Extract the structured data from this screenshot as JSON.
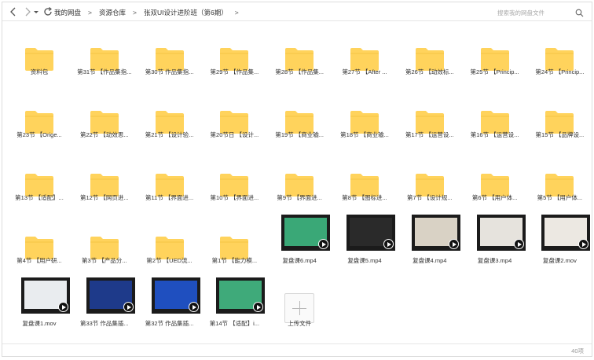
{
  "breadcrumb": [
    "我的网盘",
    "资源仓库",
    "张双UI设计进阶班（第6期）"
  ],
  "search": {
    "placeholder": "搜索我的网盘文件"
  },
  "folder_color": "#ffd35c",
  "items": [
    {
      "kind": "folder",
      "label": "资料包"
    },
    {
      "kind": "folder",
      "label": "第31节 【作品集指..."
    },
    {
      "kind": "folder",
      "label": "第30节 作品集指..."
    },
    {
      "kind": "folder",
      "label": "第29节 【作品集..."
    },
    {
      "kind": "folder",
      "label": "第28节 【作品集..."
    },
    {
      "kind": "folder",
      "label": "第27节 【After ..."
    },
    {
      "kind": "folder",
      "label": "第26节 【动效标..."
    },
    {
      "kind": "folder",
      "label": "第25节 【Princip..."
    },
    {
      "kind": "folder",
      "label": "第24节 【Princip..."
    },
    {
      "kind": "folder",
      "label": "第23节 【Orige..."
    },
    {
      "kind": "folder",
      "label": "第22节 【动效思..."
    },
    {
      "kind": "folder",
      "label": "第21节 【设计验..."
    },
    {
      "kind": "folder",
      "label": "第20节日 【设计..."
    },
    {
      "kind": "folder",
      "label": "第19节 【商业输..."
    },
    {
      "kind": "folder",
      "label": "第18节 【商业输..."
    },
    {
      "kind": "folder",
      "label": "第17节 【运营设..."
    },
    {
      "kind": "folder",
      "label": "第16节 【运营设..."
    },
    {
      "kind": "folder",
      "label": "第15节 【品牌设..."
    },
    {
      "kind": "folder",
      "label": "第13节 【适配】..."
    },
    {
      "kind": "folder",
      "label": "第12节 【网页进..."
    },
    {
      "kind": "folder",
      "label": "第11节 【界面进..."
    },
    {
      "kind": "folder",
      "label": "第10节 【界面进..."
    },
    {
      "kind": "folder",
      "label": "第9节 【界面进..."
    },
    {
      "kind": "folder",
      "label": "第8节 【图标进..."
    },
    {
      "kind": "folder",
      "label": "第7节 【设计规..."
    },
    {
      "kind": "folder",
      "label": "第6节 【用户体..."
    },
    {
      "kind": "folder",
      "label": "第5节 【用户体..."
    },
    {
      "kind": "folder",
      "label": "第4节 【用户研..."
    },
    {
      "kind": "folder",
      "label": "第3节 【产品分..."
    },
    {
      "kind": "folder",
      "label": "第2节 【UED流..."
    },
    {
      "kind": "folder",
      "label": "第1节 【能力模..."
    },
    {
      "kind": "video",
      "label": "复盘课6.mp4",
      "theme": "green"
    },
    {
      "kind": "video",
      "label": "复盘课5.mp4",
      "theme": "dark"
    },
    {
      "kind": "video",
      "label": "复盘课4.mp4",
      "theme": "colorful"
    },
    {
      "kind": "video",
      "label": "复盘课3.mp4",
      "theme": "pages"
    },
    {
      "kind": "video",
      "label": "复盘课2.mov",
      "theme": "pages2"
    },
    {
      "kind": "video",
      "label": "复盘课1.mov",
      "theme": "pages3"
    },
    {
      "kind": "video",
      "label": "第33节 作品集插...",
      "theme": "blue-circles"
    },
    {
      "kind": "video",
      "label": "第32节 作品集插...",
      "theme": "blue"
    },
    {
      "kind": "video",
      "label": "第14节 【适配】i...",
      "theme": "green2"
    },
    {
      "kind": "upload",
      "label": "上传文件"
    }
  ],
  "status": {
    "count": "40项"
  }
}
